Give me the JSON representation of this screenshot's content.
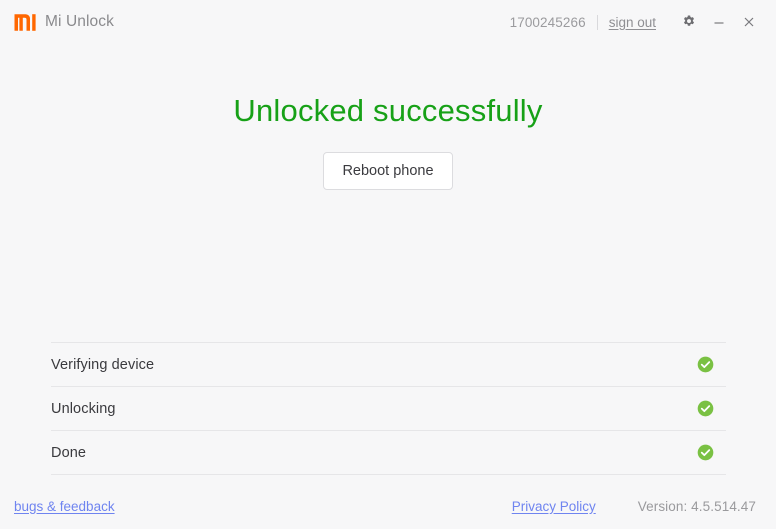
{
  "window": {
    "app_title": "Mi Unlock",
    "logo_icon": "mi-logo-icon",
    "brand_color": "#ff6700"
  },
  "titlebar": {
    "account_id": "1700245266",
    "sign_out_label": "sign out",
    "settings_icon": "gear-icon",
    "minimize_icon": "minimize-icon",
    "close_icon": "close-icon"
  },
  "main": {
    "status_heading": "Unlocked successfully",
    "status_color": "#17a117",
    "reboot_button_label": "Reboot phone"
  },
  "steps": {
    "status_icon": "check-circle-icon",
    "status_icon_color": "#7ac143",
    "items": [
      {
        "label": "Verifying device",
        "status": "complete"
      },
      {
        "label": "Unlocking",
        "status": "complete"
      },
      {
        "label": "Done",
        "status": "complete"
      }
    ]
  },
  "footer": {
    "bugs_feedback_label": "bugs & feedback",
    "privacy_policy_label": "Privacy Policy",
    "version_label": "Version: 4.5.514.47",
    "link_color": "#6f84f0"
  }
}
